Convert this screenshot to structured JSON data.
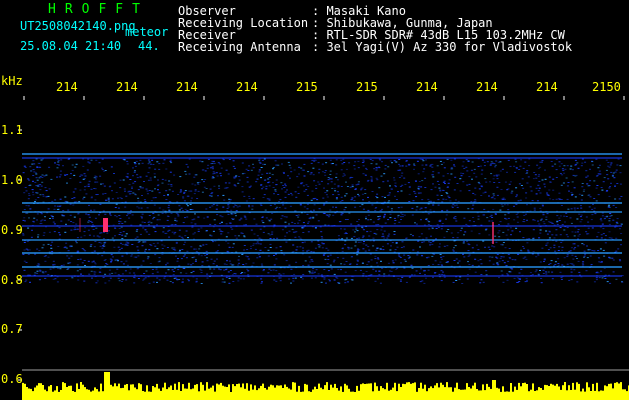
{
  "header": {
    "brand": "HROFFT",
    "filename": "UT2508042140.png",
    "mode": "meteor",
    "datetime": "25.08.04 21:40",
    "count": "44.",
    "observer_label": "Observer",
    "observer_value": ": Masaki Kano",
    "location_label": "Receiving Location",
    "location_value": ": Shibukawa, Gunma, Japan",
    "receiver_label": "Receiver",
    "receiver_value": ": RTL-SDR SDR# 43dB L15 103.2MHz CW",
    "antenna_label": "Receiving Antenna",
    "antenna_value": ": 3el Yagi(V) Az 330 for Vladivostok"
  },
  "axis": {
    "unit": "kHz",
    "time_labels": [
      "214",
      "214",
      "214",
      "214",
      "215",
      "215",
      "214",
      "214",
      "214",
      "2150"
    ],
    "freq_labels": [
      "1.1",
      "1.0",
      "0.9",
      "0.8",
      "0.7",
      "0.6"
    ]
  },
  "colors": {
    "background": "#000000",
    "text": "#ffffff",
    "labels": "#ffff00",
    "brand": "#00ff00",
    "meta": "#00ffff",
    "signal_low": "#1a3cff",
    "signal_mid": "#2a9cff",
    "meteor": "#ff3070"
  }
}
